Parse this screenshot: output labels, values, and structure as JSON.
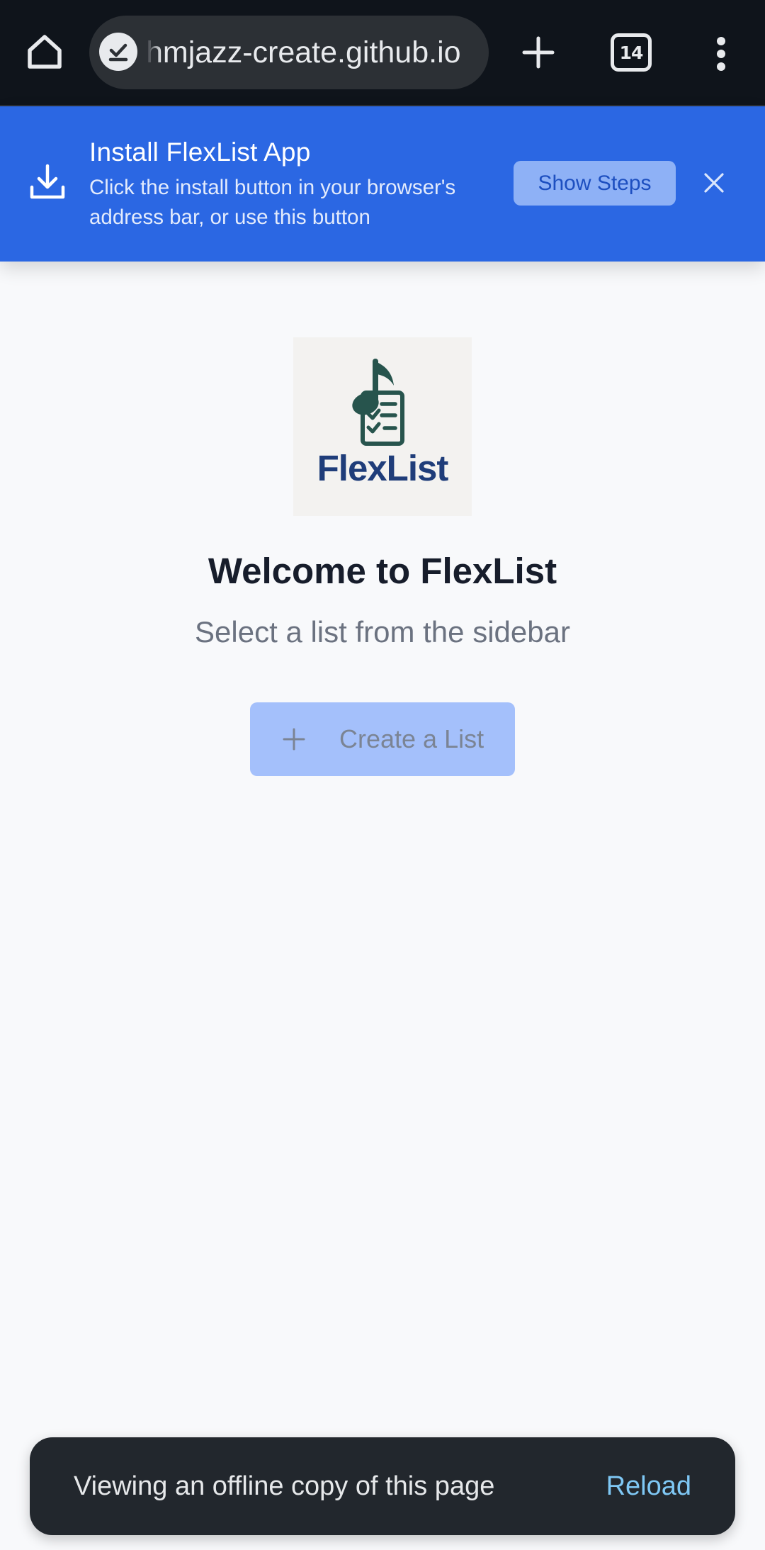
{
  "browser": {
    "url_text": "hmjazz-create.github.io",
    "tab_count": "14",
    "icons": [
      "home-icon",
      "site-check-icon",
      "plus-icon",
      "tabs-icon",
      "more-vert-icon"
    ]
  },
  "install_banner": {
    "title": "Install FlexList App",
    "description": "Click the install button in your browser's address bar, or use this button",
    "show_steps_label": "Show Steps",
    "icons": [
      "download-icon",
      "close-icon"
    ],
    "background_color": "#2b67e3"
  },
  "main": {
    "logo_text": "FlexList",
    "title": "Welcome to FlexList",
    "subtitle": "Select a list from the sidebar",
    "create_button_label": "Create a List"
  },
  "snackbar": {
    "message": "Viewing an offline copy of this page",
    "action_label": "Reload",
    "action_color": "#7fc8f5"
  }
}
